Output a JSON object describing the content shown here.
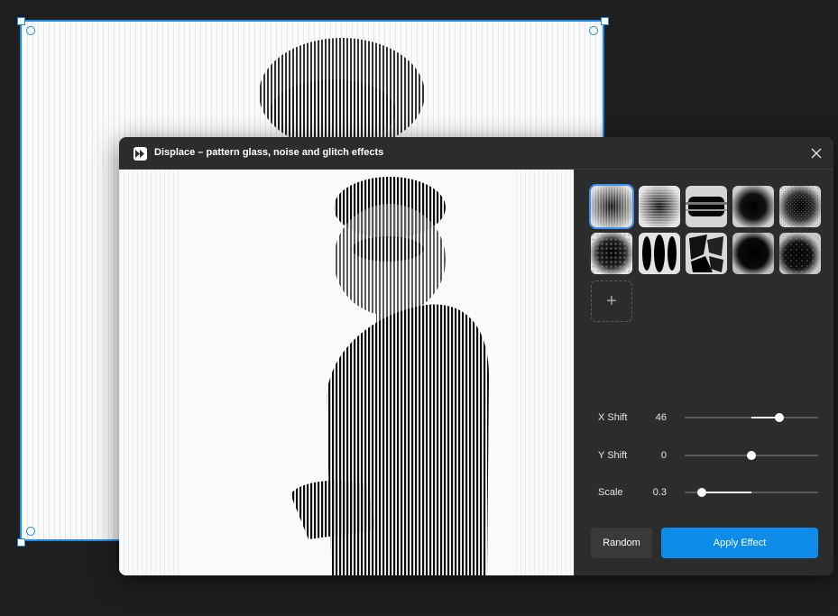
{
  "dialog": {
    "title": "Displace – pattern glass, noise and glitch effects",
    "close_icon": "close-icon",
    "plugin_icon": "fast-forward-icon"
  },
  "patterns": [
    {
      "id": "vertical-ribbed",
      "selected": true
    },
    {
      "id": "horizontal-ribbed",
      "selected": false
    },
    {
      "id": "horizontal-streak",
      "selected": false
    },
    {
      "id": "soft-radial",
      "selected": false
    },
    {
      "id": "noise-radial",
      "selected": false
    },
    {
      "id": "dotted-radial",
      "selected": false
    },
    {
      "id": "vertical-lens",
      "selected": false
    },
    {
      "id": "shards",
      "selected": false
    },
    {
      "id": "dark-blob",
      "selected": false
    },
    {
      "id": "speckle-blob",
      "selected": false
    }
  ],
  "add_pattern_label": "+",
  "controls": [
    {
      "label": "X Shift",
      "value": "46",
      "level": 0.71
    },
    {
      "label": "Y Shift",
      "value": "0",
      "level": 0.5
    },
    {
      "label": "Scale",
      "value": "0.3",
      "level": 0.13
    }
  ],
  "buttons": {
    "random": "Random",
    "apply": "Apply Effect"
  },
  "colors": {
    "accent": "#0d8ce9",
    "selection": "#1b8be6",
    "dialog_bg": "#2c2c2c",
    "workspace_bg": "#1e1e1e"
  }
}
